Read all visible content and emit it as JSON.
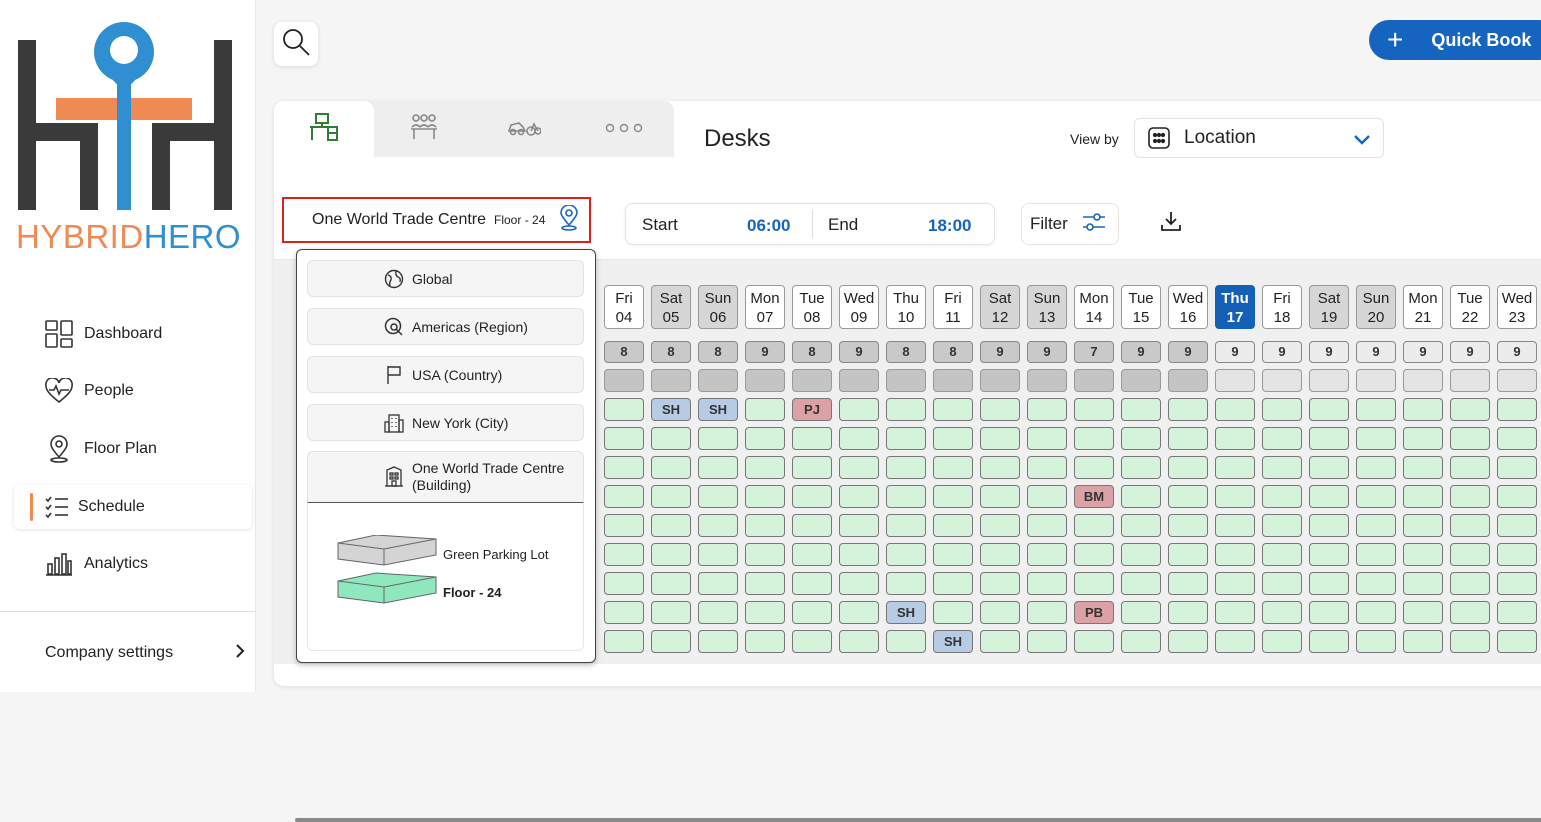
{
  "app": {
    "brand_part1": "HYBRID",
    "brand_part2": "HERO"
  },
  "sidebar": {
    "items": [
      {
        "label": "Dashboard",
        "icon": "dashboard-icon"
      },
      {
        "label": "People",
        "icon": "people-heart-icon"
      },
      {
        "label": "Floor Plan",
        "icon": "location-pin-icon"
      },
      {
        "label": "Schedule",
        "icon": "schedule-list-icon",
        "active": true
      },
      {
        "label": "Analytics",
        "icon": "bar-chart-icon"
      }
    ],
    "company_settings": "Company settings"
  },
  "header": {
    "quick_book": "Quick Book"
  },
  "tabs": [
    {
      "icon": "desk-icon",
      "active": true
    },
    {
      "icon": "meeting-room-icon"
    },
    {
      "icon": "bike-car-parking-icon"
    },
    {
      "icon": "more-icon"
    }
  ],
  "page": {
    "title": "Desks"
  },
  "view_by": {
    "label": "View by",
    "value": "Location"
  },
  "location": {
    "building": "One World Trade Centre",
    "floor": "Floor - 24"
  },
  "time": {
    "start_label": "Start",
    "start_value": "06:00",
    "end_label": "End",
    "end_value": "18:00"
  },
  "filter": {
    "label": "Filter"
  },
  "dropdown": {
    "options": [
      {
        "label": "Global",
        "icon": "globe-icon"
      },
      {
        "label": "Americas (Region)",
        "icon": "region-search-icon"
      },
      {
        "label": "USA (Country)",
        "icon": "flag-icon"
      },
      {
        "label": "New York (City)",
        "icon": "city-icon"
      },
      {
        "label": "One World Trade Centre (Building)",
        "icon": "building-icon"
      }
    ],
    "floors": [
      {
        "label": "Green Parking Lot",
        "selected": false
      },
      {
        "label": "Floor - 24",
        "selected": true
      }
    ]
  },
  "colors": {
    "accent": "#1565c0",
    "brand_orange": "#ef8a55",
    "brand_blue": "#2f8fd1",
    "available": "#d4f3da",
    "booked_sh": "#b7cbe4",
    "booked_other": "#dca1a5",
    "highlight": "#e0201c"
  },
  "calendar": {
    "days": [
      {
        "dow": "Fri",
        "date": "04",
        "count": "8",
        "type": "past"
      },
      {
        "dow": "Sat",
        "date": "05",
        "count": "8",
        "type": "weekend"
      },
      {
        "dow": "Sun",
        "date": "06",
        "count": "8",
        "type": "weekend"
      },
      {
        "dow": "Mon",
        "date": "07",
        "count": "9",
        "type": "past"
      },
      {
        "dow": "Tue",
        "date": "08",
        "count": "8",
        "type": "past"
      },
      {
        "dow": "Wed",
        "date": "09",
        "count": "9",
        "type": "past"
      },
      {
        "dow": "Thu",
        "date": "10",
        "count": "8",
        "type": "past"
      },
      {
        "dow": "Fri",
        "date": "11",
        "count": "8",
        "type": "past"
      },
      {
        "dow": "Sat",
        "date": "12",
        "count": "9",
        "type": "weekend"
      },
      {
        "dow": "Sun",
        "date": "13",
        "count": "9",
        "type": "weekend"
      },
      {
        "dow": "Mon",
        "date": "14",
        "count": "7",
        "type": "past"
      },
      {
        "dow": "Tue",
        "date": "15",
        "count": "9",
        "type": "past"
      },
      {
        "dow": "Wed",
        "date": "16",
        "count": "9",
        "type": "past"
      },
      {
        "dow": "Thu",
        "date": "17",
        "count": "9",
        "type": "today"
      },
      {
        "dow": "Fri",
        "date": "18",
        "count": "9",
        "type": "future"
      },
      {
        "dow": "Sat",
        "date": "19",
        "count": "9",
        "type": "weekend"
      },
      {
        "dow": "Sun",
        "date": "20",
        "count": "9",
        "type": "weekend"
      },
      {
        "dow": "Mon",
        "date": "21",
        "count": "9",
        "type": "future"
      },
      {
        "dow": "Tue",
        "date": "22",
        "count": "9",
        "type": "future"
      },
      {
        "dow": "Wed",
        "date": "23",
        "count": "9",
        "type": "future"
      }
    ],
    "row_count": 9,
    "bookings": [
      {
        "row": 0,
        "day": 1,
        "text": "SH",
        "kind": "sh"
      },
      {
        "row": 0,
        "day": 2,
        "text": "SH",
        "kind": "sh"
      },
      {
        "row": 0,
        "day": 4,
        "text": "PJ",
        "kind": "pj"
      },
      {
        "row": 3,
        "day": 10,
        "text": "BM",
        "kind": "bm"
      },
      {
        "row": 7,
        "day": 6,
        "text": "SH",
        "kind": "sh"
      },
      {
        "row": 7,
        "day": 10,
        "text": "PB",
        "kind": "pb"
      },
      {
        "row": 8,
        "day": 7,
        "text": "SH",
        "kind": "sh"
      }
    ]
  }
}
